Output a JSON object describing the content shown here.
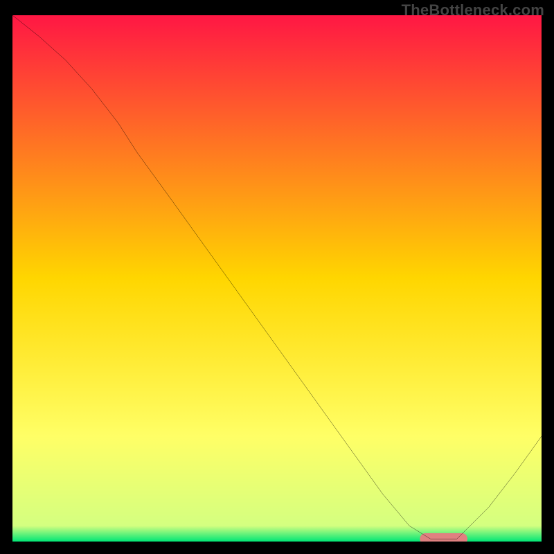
{
  "watermark": "TheBottleneck.com",
  "chart_data": {
    "type": "line",
    "title": "",
    "xlabel": "",
    "ylabel": "",
    "xlim": [
      0,
      100
    ],
    "ylim": [
      0,
      100
    ],
    "background": {
      "type": "vertical-gradient",
      "stops": [
        {
          "offset": 0,
          "color": "#ff1744"
        },
        {
          "offset": 50,
          "color": "#ffd600"
        },
        {
          "offset": 80,
          "color": "#ffff66"
        },
        {
          "offset": 97,
          "color": "#d4ff80"
        },
        {
          "offset": 100,
          "color": "#00e676"
        }
      ]
    },
    "series": [
      {
        "name": "bottleneck-curve",
        "type": "line",
        "color": "#000000",
        "x": [
          0,
          5,
          10,
          15,
          20,
          23.5,
          30,
          40,
          50,
          60,
          70,
          75,
          79,
          84,
          90,
          95,
          100
        ],
        "y": [
          100,
          96,
          91.5,
          86,
          79.5,
          74,
          65,
          51,
          37,
          23,
          9,
          3,
          0.5,
          0.5,
          6.5,
          13,
          20
        ]
      }
    ],
    "markers": [
      {
        "name": "optimal-zone",
        "shape": "rounded-rect",
        "color": "#e08080",
        "x_center": 81.5,
        "y": 0.5,
        "width": 9,
        "height": 2.2
      }
    ]
  }
}
